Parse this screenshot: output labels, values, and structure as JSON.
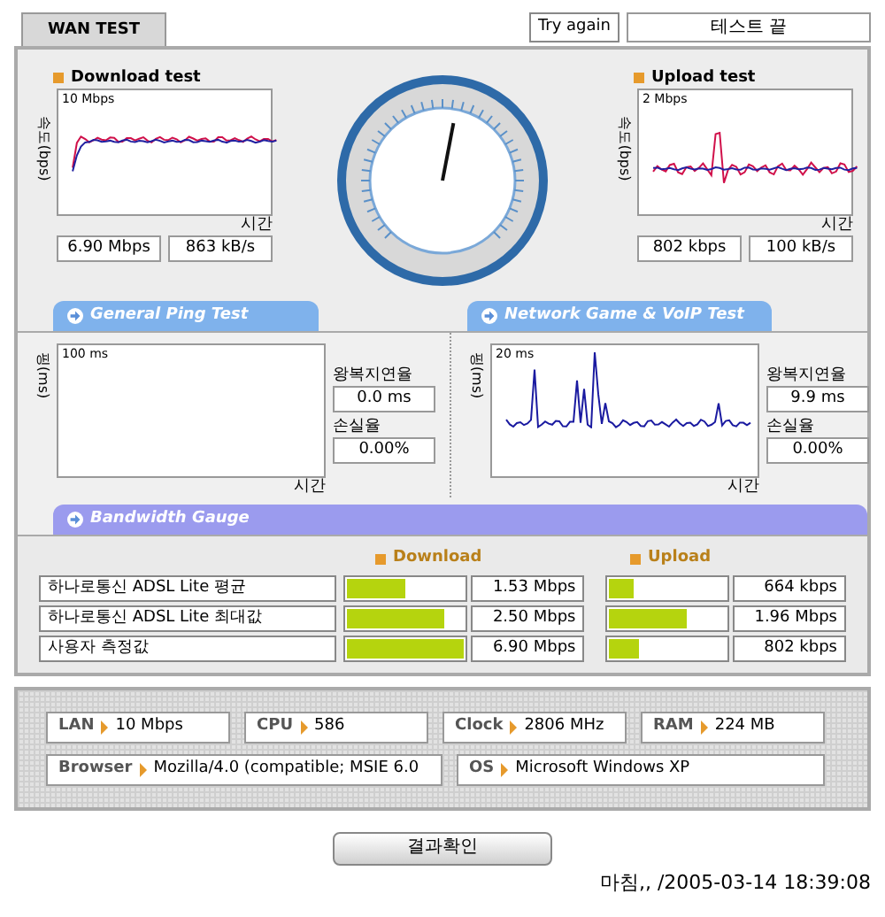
{
  "tab": {
    "label": "WAN TEST",
    "selected": true
  },
  "try_again": "Try again",
  "status": "테스트 끝",
  "download": {
    "title": "Download test",
    "axis": "속도(bps)",
    "scale": "10 Mbps",
    "time": "시간",
    "values": [
      "6.90 Mbps",
      "863 kB/s"
    ]
  },
  "gauge": {
    "level": 0.54
  },
  "upload": {
    "title": "Upload test",
    "axis": "속도(bps)",
    "scale": "2 Mbps",
    "time": "시간",
    "values": [
      "802 kbps",
      "100 kB/s"
    ]
  },
  "section_tabs": [
    "General Ping Test",
    "Network Game & VoIP Test"
  ],
  "ping": [
    {
      "axis": "핑(ms)",
      "scale": "100 ms",
      "time": "시간",
      "delay_label": "왕복지연율",
      "delay": "0.0 ms",
      "loss_label": "손실율",
      "loss": "0.00%",
      "has_data": false
    },
    {
      "axis": "핑(ms)",
      "scale": "20 ms",
      "time": "시간",
      "delay_label": "왕복지연율",
      "delay": "9.9 ms",
      "loss_label": "손실율",
      "loss": "0.00%",
      "has_data": true
    }
  ],
  "bandwidth_tab": "Bandwidth Gauge",
  "bandwidth": {
    "columns": [
      "Download",
      "Upload"
    ],
    "rows": [
      {
        "name": "하나로통신 ADSL Lite 평균",
        "download": {
          "level": 0.5,
          "value": "1.53 Mbps"
        },
        "upload": {
          "level": 0.21,
          "value": "664 kbps"
        }
      },
      {
        "name": "하나로통신 ADSL Lite 최대값",
        "download": {
          "level": 0.83,
          "value": "2.50 Mbps"
        },
        "upload": {
          "level": 0.66,
          "value": "1.96 Mbps"
        }
      },
      {
        "name": "사용자 측정값",
        "download": {
          "level": 1.0,
          "value": "6.90 Mbps"
        },
        "upload": {
          "level": 0.25,
          "value": "802 kbps"
        }
      }
    ]
  },
  "system": [
    [
      {
        "label": "LAN",
        "value": "10 Mbps"
      },
      {
        "label": "CPU",
        "value": "586"
      },
      {
        "label": "Clock",
        "value": "2806 MHz"
      },
      {
        "label": "RAM",
        "value": "224 MB"
      }
    ],
    [
      {
        "label": "Browser",
        "value": "Mozilla/4.0 (compatible; MSIE 6.0"
      },
      {
        "label": "OS",
        "value": "Microsoft Windows XP"
      }
    ]
  ],
  "result_button": "결과확인",
  "stamp": "마침,, /2005-03-14 18:39:08"
}
